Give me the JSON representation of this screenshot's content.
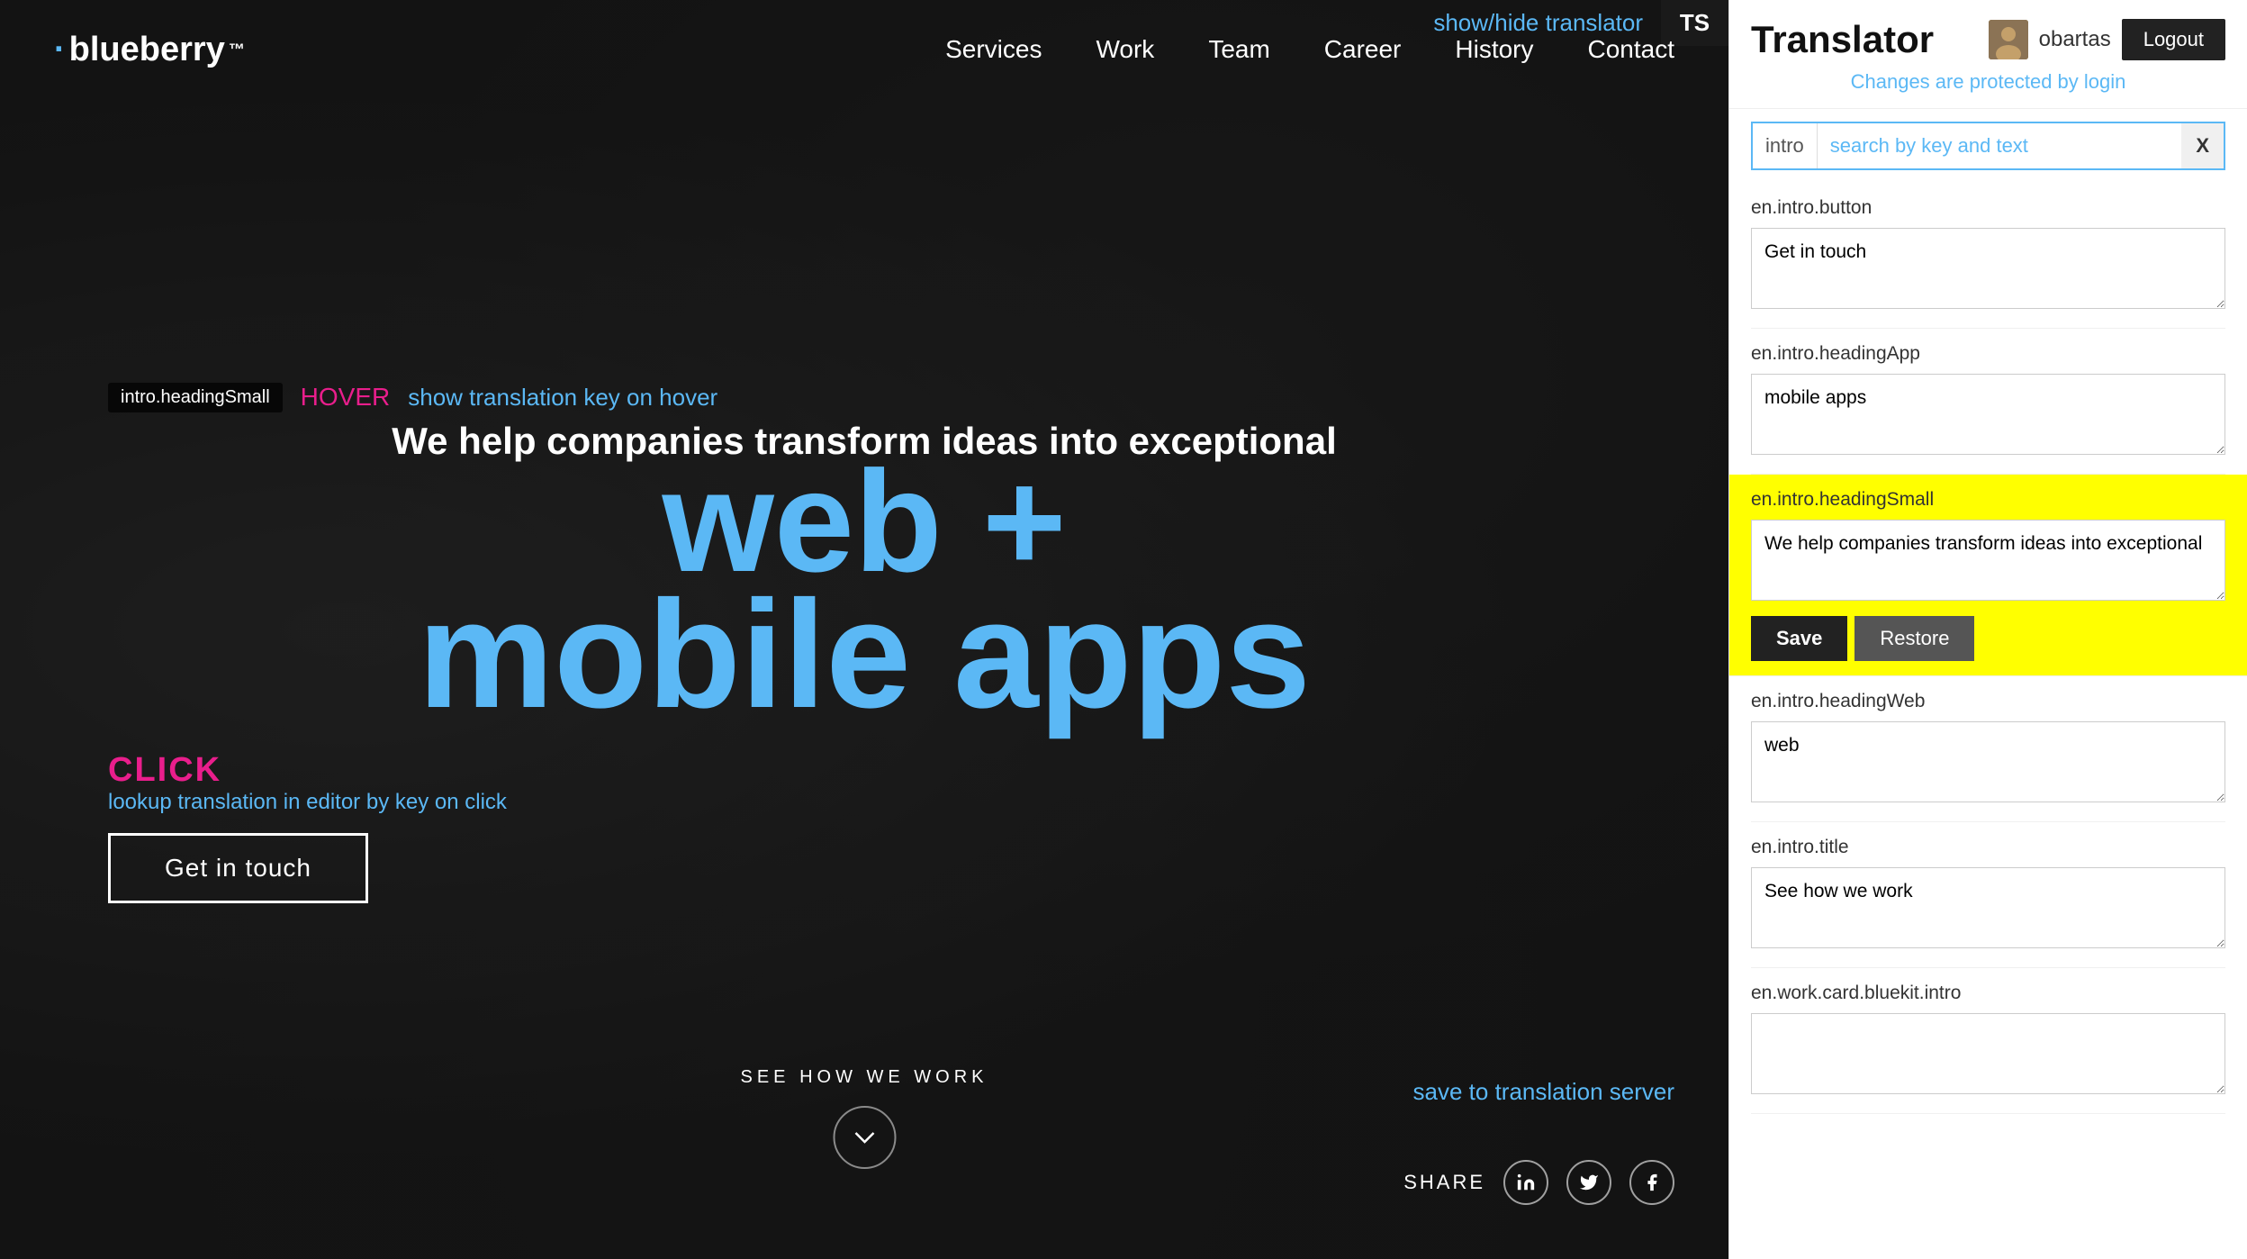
{
  "topbar": {
    "show_hide_label": "show/hide translator",
    "ts_badge": "TS"
  },
  "navbar": {
    "logo": "blueberry",
    "logo_tm": "™",
    "links": [
      {
        "label": "Services",
        "href": "#"
      },
      {
        "label": "Work",
        "href": "#"
      },
      {
        "label": "Team",
        "href": "#"
      },
      {
        "label": "Career",
        "href": "#"
      },
      {
        "label": "History",
        "href": "#"
      },
      {
        "label": "Contact",
        "href": "#"
      }
    ]
  },
  "hero": {
    "key_badge": "intro.headingSmall",
    "hover_label": "HOVER",
    "show_translation_key": "show translation key on hover",
    "heading_small": "We help companies transform ideas into exceptional",
    "heading_web": "web +",
    "heading_mobile": "mobile apps",
    "click_label": "CLICK",
    "lookup_translation": "lookup translation in editor by key on click",
    "get_in_touch": "Get in touch",
    "save_to_server": "save to translation server",
    "see_how": "SEE HOW WE WORK",
    "share_label": "SHARE"
  },
  "translator": {
    "title": "Translator",
    "username": "obartas",
    "logout_label": "Logout",
    "protected_text": "Changes are protected by login",
    "search": {
      "prefix": "intro",
      "placeholder": "search by key and text",
      "clear_label": "X"
    },
    "entries": [
      {
        "key": "en.intro.button",
        "value": "Get in touch",
        "highlighted": false
      },
      {
        "key": "en.intro.headingApp",
        "value": "mobile apps",
        "highlighted": false
      },
      {
        "key": "en.intro.headingSmall",
        "value": "We help companies transform ideas into exceptional",
        "highlighted": true
      },
      {
        "key": "en.intro.headingWeb",
        "value": "web",
        "highlighted": false
      },
      {
        "key": "en.intro.title",
        "value": "See how we work",
        "highlighted": false
      },
      {
        "key": "en.work.card.bluekit.intro",
        "value": "",
        "highlighted": false
      }
    ],
    "save_label": "Save",
    "restore_label": "Restore"
  }
}
